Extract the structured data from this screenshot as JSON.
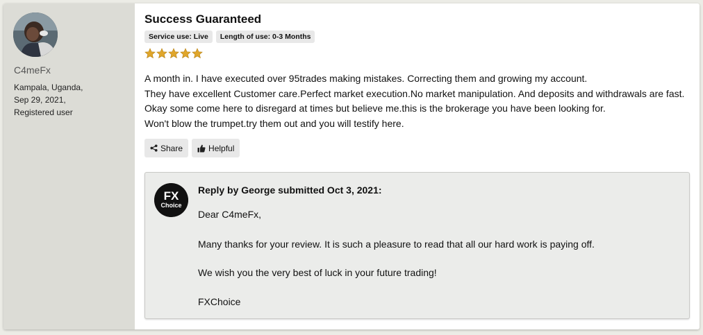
{
  "reviewer": {
    "username": "C4meFx",
    "location": "Kampala, Uganda,",
    "date": "Sep 29, 2021,",
    "status": "Registered user"
  },
  "review": {
    "title": "Success Guaranteed",
    "tags": [
      "Service use: Live",
      "Length of use: 0-3 Months"
    ],
    "rating": 5,
    "rating_max": 5,
    "star_color": "#e0a62b",
    "lines": [
      "A month in. I have executed over 95trades making mistakes. Correcting them and growing my account.",
      "They have excellent Customer care.Perfect market execution.No market manipulation. And deposits and withdrawals are fast.",
      "Okay some come here to disregard at times but believe me.this is the brokerage you have been looking for.",
      "Won't blow the trumpet.try them out and you will testify here."
    ]
  },
  "actions": {
    "share_label": "Share",
    "helpful_label": "Helpful"
  },
  "reply": {
    "logo_text_top": "FX",
    "logo_text_bottom": "Choice",
    "header": "Reply by George submitted Oct 3, 2021:",
    "greeting": "Dear C4meFx,",
    "paragraph1": "Many thanks for your review. It is such a pleasure to read that all our hard work is paying off.",
    "paragraph2": "We wish you the very best of luck in your future trading!",
    "signature": "FXChoice"
  }
}
